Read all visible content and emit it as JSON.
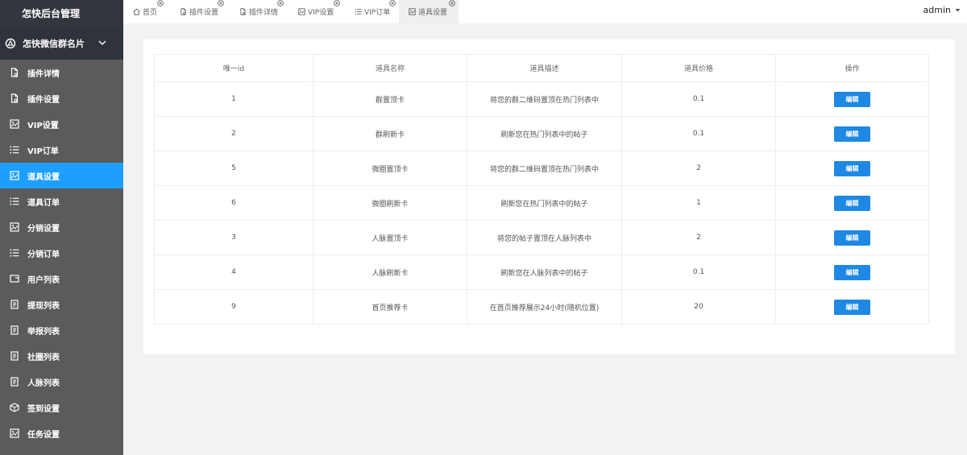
{
  "sidebar": {
    "title": "怎快后台管理",
    "group": "怎快微信群名片",
    "items": [
      {
        "label": "插件详情",
        "icon": "file-icon"
      },
      {
        "label": "插件设置",
        "icon": "file-icon"
      },
      {
        "label": "VIP设置",
        "icon": "image-icon"
      },
      {
        "label": "VIP订单",
        "icon": "list-icon"
      },
      {
        "label": "道具设置",
        "icon": "image-icon"
      },
      {
        "label": "道具订单",
        "icon": "list-icon"
      },
      {
        "label": "分销设置",
        "icon": "image-icon"
      },
      {
        "label": "分销订单",
        "icon": "list-icon"
      },
      {
        "label": "用户列表",
        "icon": "card-icon"
      },
      {
        "label": "提现列表",
        "icon": "document-icon"
      },
      {
        "label": "举报列表",
        "icon": "document-icon"
      },
      {
        "label": "社圈列表",
        "icon": "document-icon"
      },
      {
        "label": "人脉列表",
        "icon": "document-icon"
      },
      {
        "label": "签到设置",
        "icon": "box-icon"
      },
      {
        "label": "任务设置",
        "icon": "image-icon"
      }
    ],
    "active_index": 4
  },
  "tabs": [
    {
      "label": "首页",
      "icon": "home-icon"
    },
    {
      "label": "插件设置",
      "icon": "file-icon"
    },
    {
      "label": "插件详情",
      "icon": "file-icon"
    },
    {
      "label": "VIP设置",
      "icon": "image-icon"
    },
    {
      "label": "VIP订单",
      "icon": "list-icon"
    },
    {
      "label": "道具设置",
      "icon": "image-icon"
    }
  ],
  "user": {
    "name": "admin"
  },
  "table": {
    "headers": [
      "唯一id",
      "道具名称",
      "道具描述",
      "道具价格",
      "操作"
    ],
    "rows": [
      {
        "id": "1",
        "name": "群置顶卡",
        "desc": "将您的群二维码置顶在热门列表中",
        "price": "0.1"
      },
      {
        "id": "2",
        "name": "群刷新卡",
        "desc": "刷新您在热门列表中的帖子",
        "price": "0.1"
      },
      {
        "id": "5",
        "name": "微圈置顶卡",
        "desc": "将您的群二维码置顶在热门列表中",
        "price": "2"
      },
      {
        "id": "6",
        "name": "微圈刷新卡",
        "desc": "刷新您在热门列表中的帖子",
        "price": "1"
      },
      {
        "id": "3",
        "name": "人脉置顶卡",
        "desc": "将您的帖子置顶在人脉列表中",
        "price": "2"
      },
      {
        "id": "4",
        "name": "人脉刷新卡",
        "desc": "刷新您在人脉列表中的帖子",
        "price": "0.1"
      },
      {
        "id": "9",
        "name": "首页推荐卡",
        "desc": "在首页推荐展示24小时(随机位置)",
        "price": "20"
      }
    ],
    "action_label": "编辑"
  },
  "colors": {
    "sidebar_bg": "#5b5b5b",
    "sidebar_header_bg": "#2f333a",
    "active": "#1e9fff",
    "button": "#1e88e5"
  }
}
